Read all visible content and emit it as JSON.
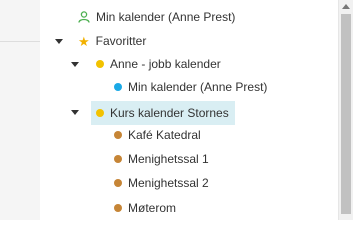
{
  "tree": {
    "items": [
      {
        "label": "Min kalender (Anne Prest)",
        "icon": "person-icon",
        "color": "#4caf50"
      },
      {
        "label": "Favoritter",
        "icon": "star-icon",
        "color": "#f2b100",
        "expanded": true
      },
      {
        "label": "Anne - jobb kalender",
        "icon": "calendar-dot",
        "color": "#f2c200",
        "expanded": true
      },
      {
        "label": "Min kalender (Anne Prest)",
        "icon": "calendar-dot",
        "color": "#1aa9e6"
      },
      {
        "label": "Kurs kalender Stornes",
        "icon": "calendar-dot",
        "color": "#f2c200",
        "expanded": true,
        "selected": true
      },
      {
        "label": "Kafé Katedral",
        "icon": "calendar-dot",
        "color": "#c68536"
      },
      {
        "label": "Menighetssal 1",
        "icon": "calendar-dot",
        "color": "#c68536"
      },
      {
        "label": "Menighetssal 2",
        "icon": "calendar-dot",
        "color": "#c68536"
      },
      {
        "label": "Møterom",
        "icon": "calendar-dot",
        "color": "#c68536"
      }
    ]
  },
  "colors": {
    "selected_bg": "#d9eef3",
    "text": "#333333"
  }
}
